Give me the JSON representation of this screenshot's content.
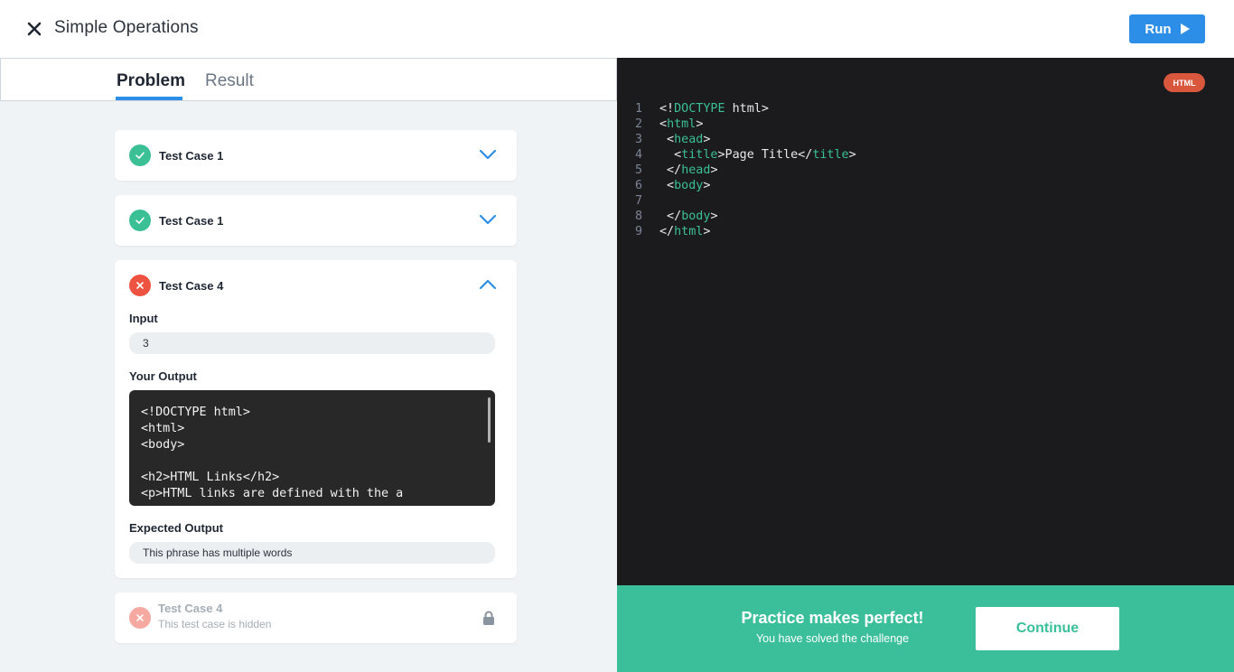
{
  "header": {
    "title": "Simple Operations",
    "run_label": "Run"
  },
  "tabs": [
    {
      "label": "Problem",
      "active": true
    },
    {
      "label": "Result",
      "active": false
    }
  ],
  "cases": [
    {
      "label": "Test Case 1",
      "status": "pass",
      "expanded": false
    },
    {
      "label": "Test Case 1",
      "status": "pass",
      "expanded": false
    },
    {
      "label": "Test Case 4",
      "status": "fail",
      "expanded": true,
      "input_label": "Input",
      "input_value": "3",
      "output_label": "Your Output",
      "output_code": "<!DOCTYPE html>\n<html>\n<body>\n\n<h2>HTML Links</h2>\n<p>HTML links are defined with the a",
      "expected_label": "Expected Output",
      "expected_value": "This phrase has multiple words"
    },
    {
      "label": "Test Case 4",
      "status": "hidden",
      "subtitle": "This test case is hidden"
    }
  ],
  "editor": {
    "language": "HTML",
    "lines": [
      {
        "n": "1",
        "parts": [
          {
            "t": "<!"
          },
          {
            "t": "DOCTYPE",
            "tag": true
          },
          {
            "t": " html>"
          }
        ]
      },
      {
        "n": "2",
        "parts": [
          {
            "t": "<"
          },
          {
            "t": "html",
            "tag": true
          },
          {
            "t": ">"
          }
        ]
      },
      {
        "n": "3",
        "parts": [
          {
            "t": " <"
          },
          {
            "t": "head",
            "tag": true
          },
          {
            "t": ">"
          }
        ]
      },
      {
        "n": "4",
        "parts": [
          {
            "t": "  <"
          },
          {
            "t": "title",
            "tag": true
          },
          {
            "t": ">Page Title</"
          },
          {
            "t": "title",
            "tag": true
          },
          {
            "t": ">"
          }
        ]
      },
      {
        "n": "5",
        "parts": [
          {
            "t": " </"
          },
          {
            "t": "head",
            "tag": true
          },
          {
            "t": ">"
          }
        ]
      },
      {
        "n": "6",
        "parts": [
          {
            "t": " <"
          },
          {
            "t": "body",
            "tag": true
          },
          {
            "t": ">"
          }
        ]
      },
      {
        "n": "7",
        "parts": [
          {
            "t": ""
          }
        ]
      },
      {
        "n": "8",
        "parts": [
          {
            "t": " </"
          },
          {
            "t": "body",
            "tag": true
          },
          {
            "t": ">"
          }
        ]
      },
      {
        "n": "9",
        "parts": [
          {
            "t": "</"
          },
          {
            "t": "html",
            "tag": true
          },
          {
            "t": ">"
          }
        ]
      }
    ]
  },
  "footer": {
    "title": "Practice makes perfect!",
    "subtitle": "You have solved the challenge",
    "continue_label": "Continue"
  },
  "colors": {
    "accent": "#2c8ee6",
    "success": "#3bbf94",
    "error": "#ee5240",
    "badge": "#d9573d"
  },
  "icons": [
    "close-icon",
    "play-icon",
    "check-icon",
    "x-icon",
    "chevron-down-icon",
    "chevron-up-icon",
    "lock-icon"
  ]
}
